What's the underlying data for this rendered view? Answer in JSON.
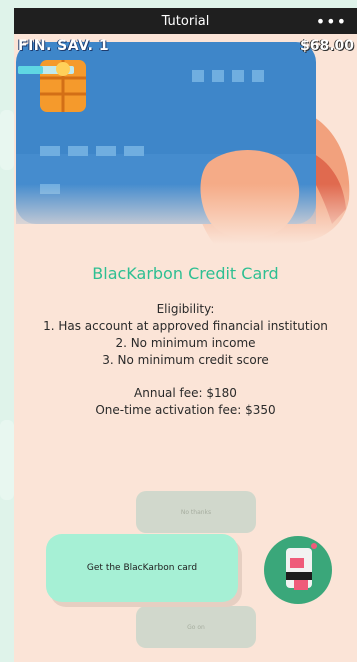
{
  "statusbar": {
    "title": "Tutorial",
    "menu_icon": "more-dots-icon",
    "menu_glyph": "•••"
  },
  "hud": {
    "level_label": "FIN. SAV. 1",
    "money": "$68.00",
    "progress": 0.45
  },
  "card": {
    "title": "BlacKarbon Credit Card",
    "eligibility_heading": "Eligibility:",
    "eligibility_items": [
      "1. Has account at approved financial institution",
      "2. No minimum income",
      "3. No minimum credit score"
    ],
    "annual_fee": "Annual fee: $180",
    "activation_fee": "One-time activation fee: $350"
  },
  "actions": {
    "primary_label": "Get the BlacKarbon card",
    "top_ghost_label": "No thanks",
    "bottom_ghost_label": "Go on"
  },
  "colors": {
    "accent": "#2ebf92",
    "card_blue": "#3e86c9",
    "button_mint": "#a6f0d5",
    "background_peach": "#fbe4d7"
  }
}
